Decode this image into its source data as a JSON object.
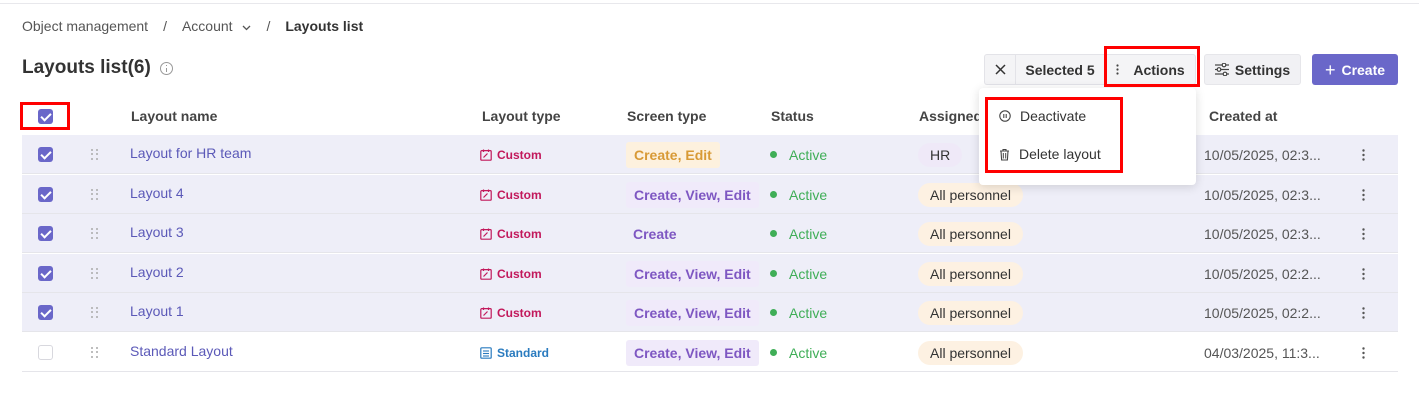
{
  "breadcrumb": {
    "items": [
      "Object management",
      "Account",
      "Layouts list"
    ],
    "separator": "/"
  },
  "page": {
    "title": "Layouts list(6)"
  },
  "toolbar": {
    "selected_label": "Selected 5",
    "actions_label": "Actions",
    "settings_label": "Settings",
    "create_label": "Create",
    "create_color": "#6a67c9"
  },
  "actions_menu": {
    "items": [
      {
        "label": "Deactivate",
        "icon": "pause-circle-icon"
      },
      {
        "label": "Delete layout",
        "icon": "trash-icon"
      }
    ]
  },
  "table": {
    "columns": [
      "Layout name",
      "Layout type",
      "Screen type",
      "Status",
      "Assigned",
      "Created at"
    ],
    "all_selected": true,
    "rows": [
      {
        "selected": true,
        "name": "Layout for HR team",
        "type": "Custom",
        "screen": "Create, Edit",
        "screen_style": "yellow",
        "status": "Active",
        "assigned": "HR",
        "created": "10/05/2025, 02:3..."
      },
      {
        "selected": true,
        "name": "Layout 4",
        "type": "Custom",
        "screen": "Create, View, Edit",
        "screen_style": "purple",
        "status": "Active",
        "assigned": "All personnel",
        "created": "10/05/2025, 02:3..."
      },
      {
        "selected": true,
        "name": "Layout 3",
        "type": "Custom",
        "screen": "Create",
        "screen_style": "plain",
        "status": "Active",
        "assigned": "All personnel",
        "created": "10/05/2025, 02:3..."
      },
      {
        "selected": true,
        "name": "Layout 2",
        "type": "Custom",
        "screen": "Create, View, Edit",
        "screen_style": "purple",
        "status": "Active",
        "assigned": "All personnel",
        "created": "10/05/2025, 02:2..."
      },
      {
        "selected": true,
        "name": "Layout 1",
        "type": "Custom",
        "screen": "Create, View, Edit",
        "screen_style": "purple",
        "status": "Active",
        "assigned": "All personnel",
        "created": "10/05/2025, 02:2..."
      },
      {
        "selected": false,
        "name": "Standard Layout",
        "type": "Standard",
        "screen": "Create, View, Edit",
        "screen_style": "purple",
        "status": "Active",
        "assigned": "All personnel",
        "created": "04/03/2025, 11:3..."
      }
    ]
  },
  "colors": {
    "accent": "#6a67c9",
    "custom_type": "#c2185b",
    "standard_type": "#2a7bbf",
    "active_status": "#3fae57",
    "highlight": "#ff0000"
  }
}
